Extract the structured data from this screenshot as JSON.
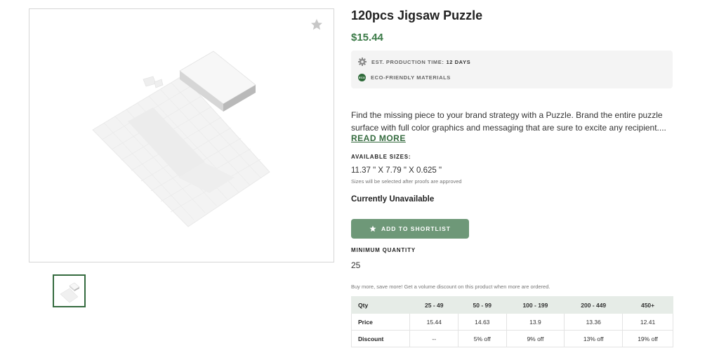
{
  "product": {
    "title": "120pcs Jigsaw Puzzle",
    "price": "$15.44",
    "production_label": "EST. PRODUCTION TIME:",
    "production_days": "12 DAYS",
    "eco_badge": "ECO",
    "eco_label": "ECO-FRIENDLY MATERIALS",
    "description": "Find the missing piece to your brand strategy with a Puzzle.  Brand the entire puzzle surface with full color graphics and messaging that are sure to excite any recipient....",
    "read_more": "READ MORE",
    "sizes_label": "AVAILABLE SIZES:",
    "sizes_value": "11.37 \" X 7.79 \" X 0.625 \"",
    "sizes_note": "Sizes will be selected after proofs are approved",
    "availability": "Currently Unavailable",
    "shortlist_button": "ADD TO SHORTLIST",
    "min_qty_label": "MINIMUM QUANTITY",
    "min_qty_value": "25",
    "bulk_note": "Buy more, save more! Get a volume discount on this product when more are ordered."
  },
  "pricing_table": {
    "headers": [
      "Qty",
      "25 - 49",
      "50 - 99",
      "100 - 199",
      "200 - 449",
      "450+"
    ],
    "price_row": [
      "Price",
      "15.44",
      "14.63",
      "13.9",
      "13.36",
      "12.41"
    ],
    "discount_row": [
      "Discount",
      "--",
      "5% off",
      "9% off",
      "13% off",
      "19% off"
    ]
  },
  "icons": {
    "favorite": "star-icon",
    "production": "gear-icon",
    "eco": "eco-badge-icon",
    "shortlist": "star-icon"
  },
  "colors": {
    "brand_green": "#3b7a47",
    "button_green": "#6e9878",
    "table_header": "#e6ece7"
  }
}
